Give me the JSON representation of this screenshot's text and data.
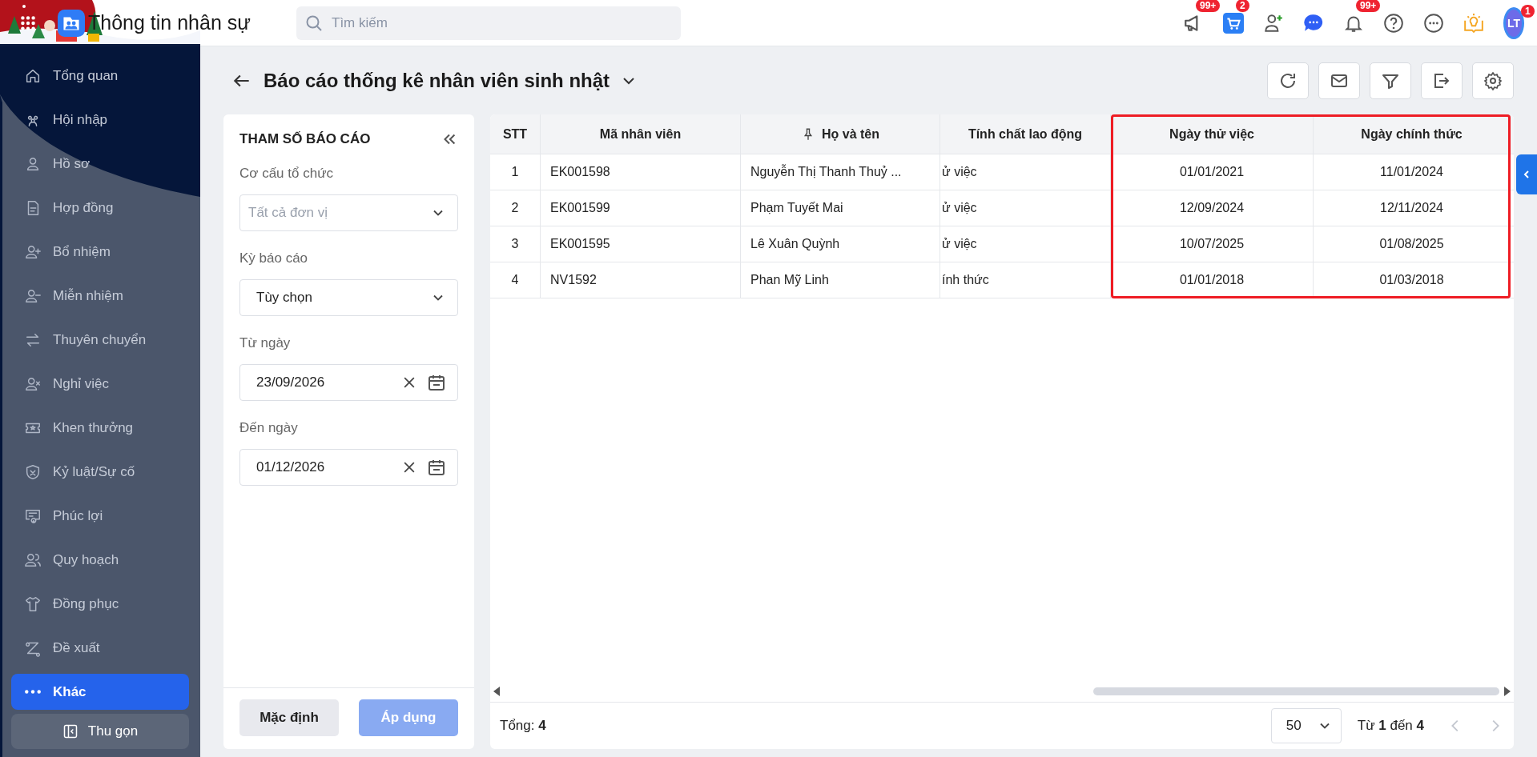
{
  "app": {
    "title": "Thông tin nhân sự"
  },
  "search": {
    "placeholder": "Tìm kiếm"
  },
  "badges": {
    "announcements": "99+",
    "cart": "2",
    "alerts": "99+"
  },
  "avatar": {
    "initials": "LT",
    "badge": "1"
  },
  "sidebar": {
    "items": [
      {
        "label": "Tổng quan",
        "selected": false
      },
      {
        "label": "Hội nhập",
        "selected": false
      },
      {
        "label": "Hồ sơ",
        "selected": false
      },
      {
        "label": "Hợp đồng",
        "selected": false
      },
      {
        "label": "Bổ nhiệm",
        "selected": false
      },
      {
        "label": "Miễn nhiệm",
        "selected": false
      },
      {
        "label": "Thuyên chuyển",
        "selected": false
      },
      {
        "label": "Nghỉ việc",
        "selected": false
      },
      {
        "label": "Khen thưởng",
        "selected": false
      },
      {
        "label": "Kỷ luật/Sự cố",
        "selected": false
      },
      {
        "label": "Phúc lợi",
        "selected": false
      },
      {
        "label": "Quy hoạch",
        "selected": false
      },
      {
        "label": "Đồng phục",
        "selected": false
      },
      {
        "label": "Đề xuất",
        "selected": false
      },
      {
        "label": "Khác",
        "selected": true
      }
    ],
    "collapse": "Thu gọn"
  },
  "page": {
    "title": "Báo cáo thống kê nhân viên sinh nhật"
  },
  "params": {
    "title": "THAM SỐ BÁO CÁO",
    "fields": [
      {
        "kind": "select",
        "label": "Cơ cấu tổ chức",
        "placeholder": "Tất cả đơn vị"
      },
      {
        "kind": "select",
        "label": "Kỳ báo cáo",
        "value": "Tùy chọn"
      },
      {
        "kind": "date",
        "label": "Từ ngày",
        "value": "23/09/2026"
      },
      {
        "kind": "date",
        "label": "Đến ngày",
        "value": "01/12/2026"
      }
    ],
    "buttons": [
      {
        "label": "Mặc định",
        "kind": "secondary",
        "disabled": false
      },
      {
        "label": "Áp dụng",
        "kind": "primary",
        "disabled": true
      }
    ]
  },
  "table": {
    "columns": [
      {
        "label": "STT",
        "pinned": false,
        "highlighted": false
      },
      {
        "label": "Mã nhân viên",
        "pinned": false,
        "highlighted": false
      },
      {
        "label": "Họ và tên",
        "pinned": true,
        "highlighted": false
      },
      {
        "label": "Tính chất lao động",
        "pinned": false,
        "highlighted": false
      },
      {
        "label": "Ngày thử việc",
        "pinned": false,
        "highlighted": true
      },
      {
        "label": "Ngày chính thức",
        "pinned": false,
        "highlighted": true
      }
    ],
    "rows": [
      [
        "1",
        "EK001598",
        "Nguyễn Thị Thanh Thuỷ ...",
        "ử việc",
        "01/01/2021",
        "11/01/2024"
      ],
      [
        "2",
        "EK001599",
        "Phạm Tuyết Mai",
        "ử việc",
        "12/09/2024",
        "12/11/2024"
      ],
      [
        "3",
        "EK001595",
        "Lê Xuân Quỳnh",
        "ử việc",
        "10/07/2025",
        "01/08/2025"
      ],
      [
        "4",
        "NV1592",
        "Phan Mỹ Linh",
        "ính thức",
        "01/01/2018",
        "01/03/2018"
      ]
    ],
    "total": "Tổng: **4**",
    "page_size": "50",
    "range": "Từ **1** đến **4**",
    "prev_disabled": true,
    "next_disabled": true
  }
}
